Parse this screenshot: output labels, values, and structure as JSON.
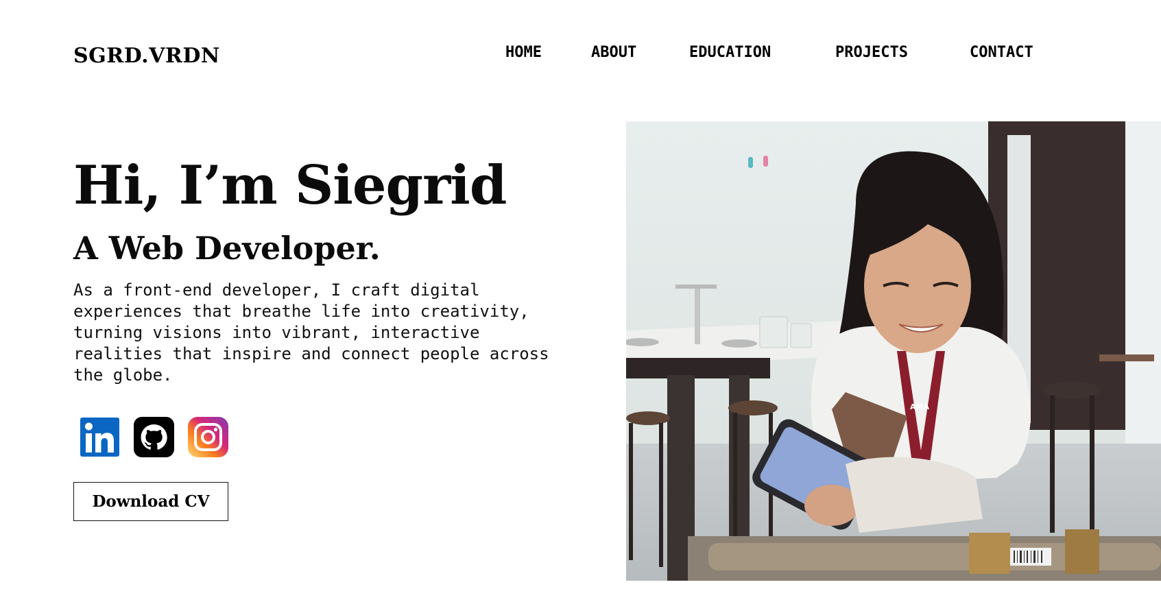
{
  "header": {
    "logo": "SGRD.VRDN",
    "nav": [
      {
        "label": "HOME"
      },
      {
        "label": "ABOUT"
      },
      {
        "label": "EDUCATION"
      },
      {
        "label": "PROJECTS"
      },
      {
        "label": "CONTACT"
      }
    ]
  },
  "hero": {
    "title": "Hi, I’m Siegrid",
    "subtitle": "A Web Developer.",
    "description": "As a front-end developer, I craft digital experiences that breathe life into creativity, turning visions into vibrant, interactive realities that inspire and connect people across the globe.",
    "socials": [
      {
        "icon": "linkedin-icon"
      },
      {
        "icon": "github-icon"
      },
      {
        "icon": "instagram-icon"
      }
    ],
    "cv_button": "Download CV"
  },
  "photo": {
    "subject": "profile-photo",
    "lanyard_text": "AMA"
  },
  "colors": {
    "text": "#000000",
    "background": "#ffffff",
    "linkedin": "#0a66c2",
    "github": "#000000",
    "instagram_start": "#feda75",
    "instagram_end": "#833ab4"
  }
}
